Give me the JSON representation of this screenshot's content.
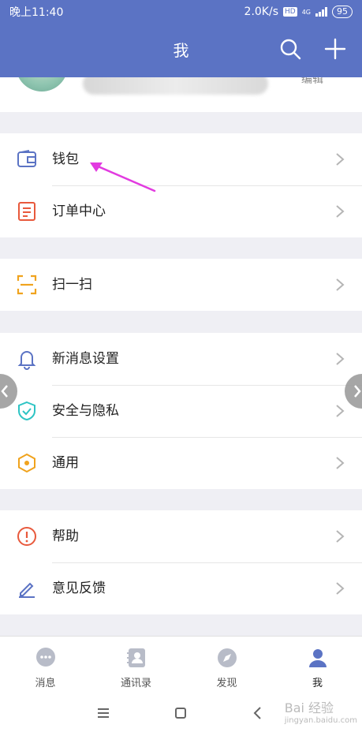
{
  "status": {
    "time": "晚上11:40",
    "speed": "2.0K/s",
    "hd": "HD",
    "network": "4G",
    "battery": "95"
  },
  "header": {
    "title": "我"
  },
  "profile": {
    "edge_text": "编辑"
  },
  "menu": {
    "wallet": "钱包",
    "orders": "订单中心",
    "scan": "扫一扫",
    "notifications": "新消息设置",
    "privacy": "安全与隐私",
    "general": "通用",
    "help": "帮助",
    "feedback": "意见反馈"
  },
  "tabs": [
    {
      "label": "消息"
    },
    {
      "label": "通讯录"
    },
    {
      "label": "发现"
    },
    {
      "label": "我"
    }
  ],
  "watermark": {
    "text": "Bai 经验",
    "sub": "jingyan.baidu.com"
  },
  "colors": {
    "header": "#5b73c4",
    "annotation": "#e23be0"
  }
}
